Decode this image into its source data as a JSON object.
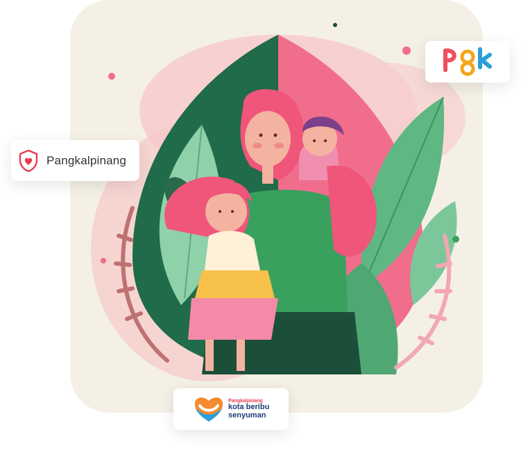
{
  "illustration": {
    "subject": "mother-with-two-children-illustration",
    "palette": {
      "background": "#f4f0e5",
      "pink": "#f06d8c",
      "dark_green": "#1f6b4a",
      "leaf_green": "#5fb784",
      "skin": "#f4b3a0"
    }
  },
  "city_badge": {
    "icon": "shield-heart-icon",
    "label": "Pangkalpinang",
    "accent": "#e53b50"
  },
  "brand_logo": {
    "text": "PGK",
    "colors": [
      "#f04e5e",
      "#f7a31c",
      "#2a9fd8"
    ]
  },
  "slogan_logo": {
    "city": "Pangkalpinang",
    "line1": "kota beribu",
    "line2": "senyuman",
    "icon": "heart-smile-icon"
  }
}
